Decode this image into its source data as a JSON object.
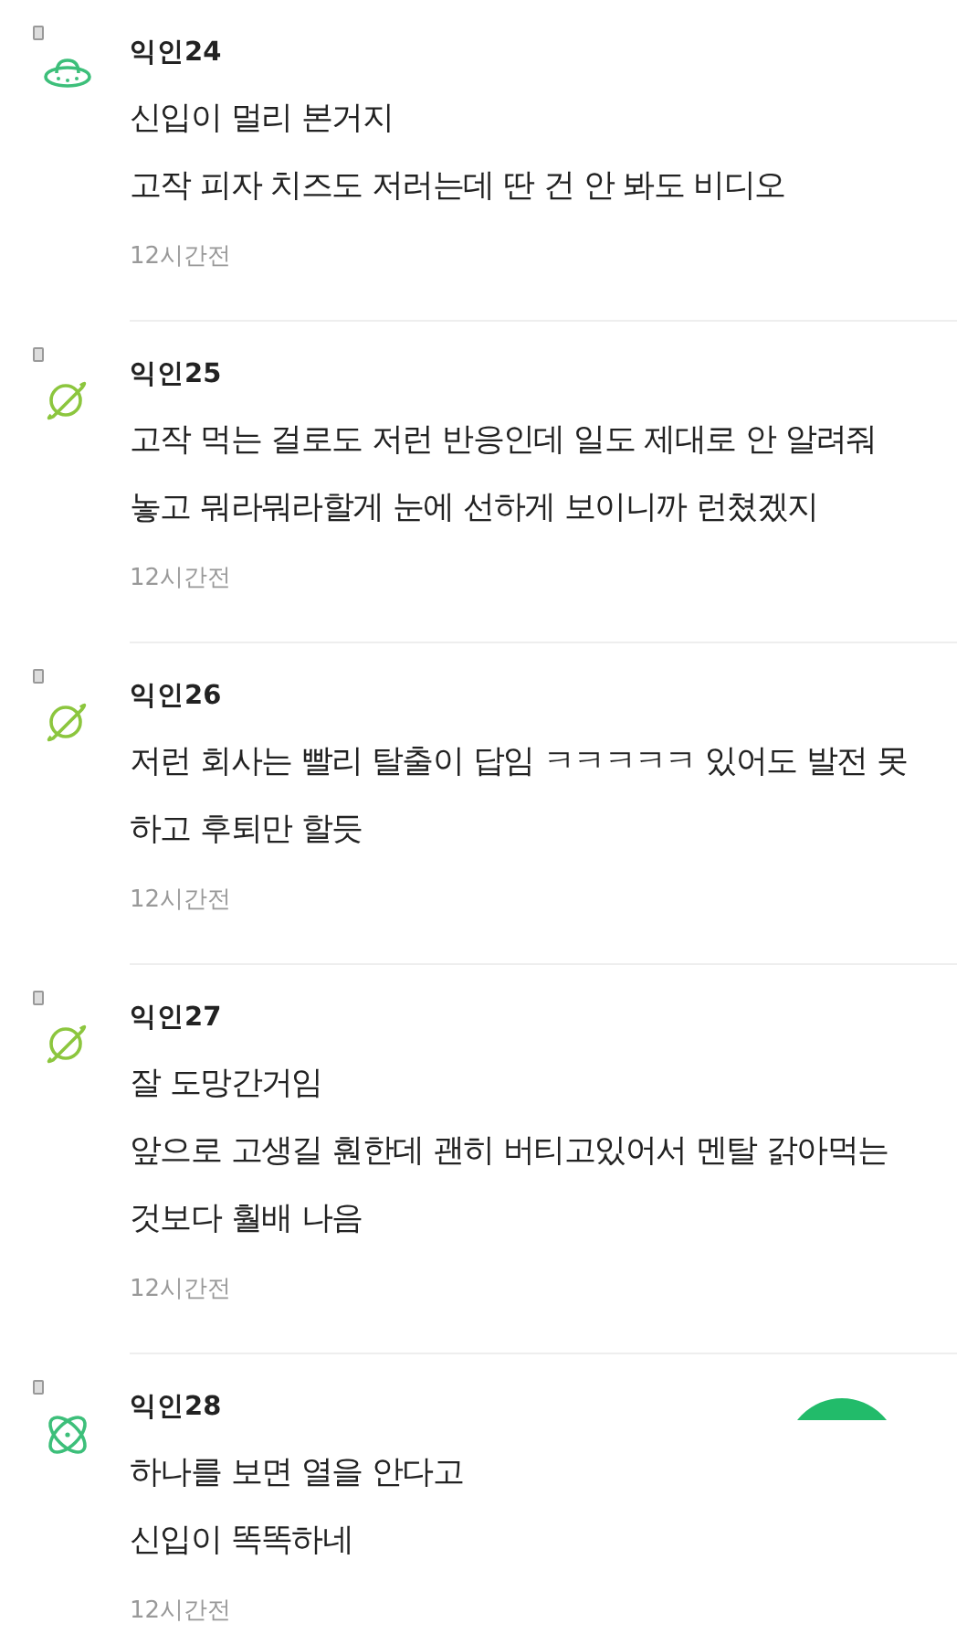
{
  "comments": [
    {
      "kind": "ufo",
      "author": "익인24",
      "body": [
        "신입이 멀리 본거지",
        "고작 피자 치즈도 저러는데 딴 건 안 봐도 비디오"
      ],
      "time": "12시간전"
    },
    {
      "kind": "planet",
      "author": "익인25",
      "body": [
        "고작 먹는 걸로도 저런 반응인데 일도 제대로 안 알려줘 놓고 뭐라뭐라할게 눈에 선하게 보이니까 런쳤겠지"
      ],
      "time": "12시간전"
    },
    {
      "kind": "planet",
      "author": "익인26",
      "body": [
        "저런 회사는 빨리 탈출이 답임 ㅋㅋㅋㅋㅋ 있어도 발전 못하고 후퇴만 할듯"
      ],
      "time": "12시간전"
    },
    {
      "kind": "planet",
      "author": "익인27",
      "body": [
        "잘 도망간거임",
        "앞으로 고생길 훤한데 괜히 버티고있어서 멘탈 갉아먹는 것보다 훨배 나음"
      ],
      "time": "12시간전"
    },
    {
      "kind": "atom",
      "author": "익인28",
      "body": [
        "하나를 보면 열을 안다고",
        "신입이 똑똑하네"
      ],
      "time": "12시간전"
    }
  ]
}
